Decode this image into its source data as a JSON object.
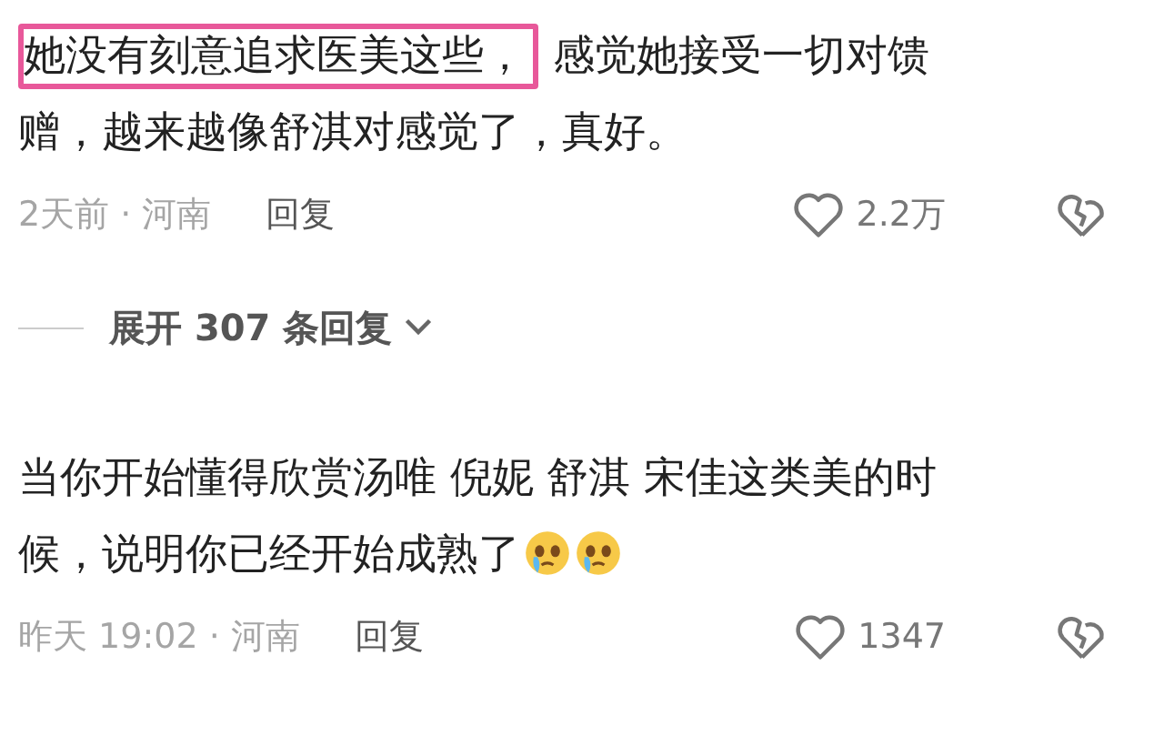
{
  "comments": [
    {
      "parts": [
        {
          "text": "她没有刻意追求医美这些，",
          "highlighted": true
        },
        {
          "text": "感觉她接受一切对馈赠，越来越像舒淇对感觉了，真好。",
          "highlighted": false
        }
      ],
      "meta": "2天前 · 河南",
      "reply": "回复",
      "likes": "2.2万",
      "replies_toggle": "展开 307 条回复"
    },
    {
      "parts": [
        {
          "text": "当你开始懂得欣赏汤唯 倪妮 舒淇 宋佳这类美的时候，说明你已经开始成熟了",
          "highlighted": false
        }
      ],
      "emojis": [
        {
          "kind": "crying"
        },
        {
          "kind": "crying"
        }
      ],
      "meta": "昨天 19:02 · 河南",
      "reply": "回复",
      "likes": "1347"
    }
  ]
}
